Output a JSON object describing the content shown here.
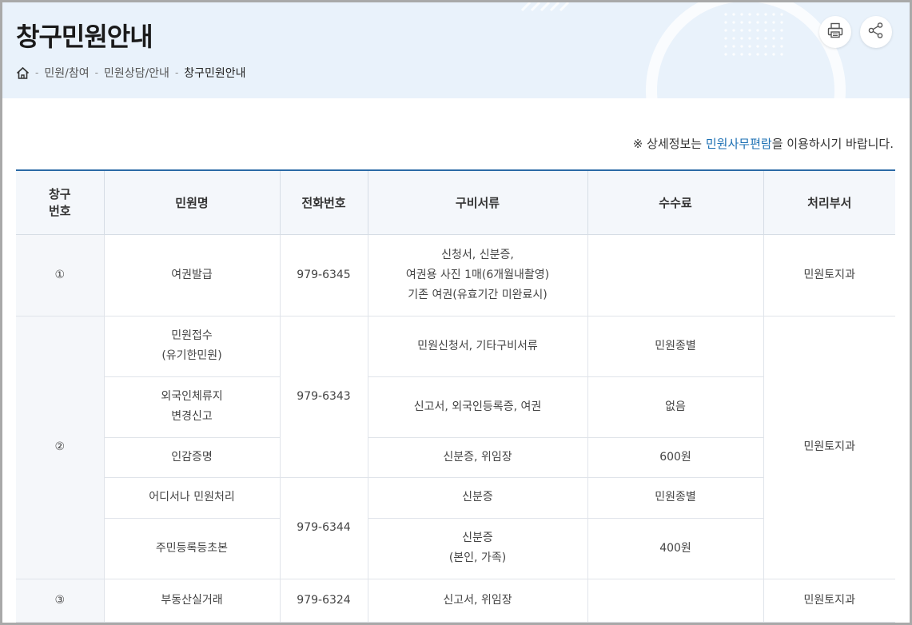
{
  "header": {
    "title": "창구민원안내",
    "breadcrumb": [
      "민원/참여",
      "민원상담/안내",
      "창구민원안내"
    ],
    "separator": "-",
    "icons": {
      "home": "home-icon",
      "print": "print-icon",
      "share": "share-icon"
    }
  },
  "notice": {
    "prefix": "※ 상세정보는 ",
    "link": "민원사무편람",
    "suffix": "을 이용하시기 바랍니다."
  },
  "table": {
    "headers": {
      "num_line1": "창구",
      "num_line2": "번호",
      "name": "민원명",
      "phone": "전화번호",
      "docs": "구비서류",
      "fee": "수수료",
      "dept": "처리부서"
    },
    "groups": [
      {
        "num": "①",
        "dept": "민원토지과",
        "rows": [
          {
            "name": [
              "여권발급"
            ],
            "phone": "979-6345",
            "docs": [
              "신청서, 신분증,",
              "여권용 사진 1매(6개월내촬영)",
              "기존 여권(유효기간 미완료시)"
            ],
            "fee": ""
          }
        ]
      },
      {
        "num": "②",
        "dept": "민원토지과",
        "rows": [
          {
            "name": [
              "민원접수",
              "(유기한민원)"
            ],
            "phone": "979-6343",
            "docs": [
              "민원신청서, 기타구비서류"
            ],
            "fee": "민원종별"
          },
          {
            "name": [
              "외국인체류지",
              "변경신고"
            ],
            "docs": [
              "신고서, 외국인등록증, 여권"
            ],
            "fee": "없음"
          },
          {
            "name": [
              "인감증명"
            ],
            "docs": [
              "신분증, 위임장"
            ],
            "fee": "600원"
          },
          {
            "name": [
              "어디서나 민원처리"
            ],
            "phone": "979-6344",
            "docs": [
              "신분증"
            ],
            "fee": "민원종별"
          },
          {
            "name": [
              "주민등록등초본"
            ],
            "docs": [
              "신분증",
              "(본인, 가족)"
            ],
            "fee": "400원"
          }
        ]
      },
      {
        "num": "③",
        "dept": "민원토지과",
        "rows": [
          {
            "name": [
              "부동산실거래"
            ],
            "phone": "979-6324",
            "docs": [
              "신고서, 위임장"
            ],
            "fee": ""
          }
        ]
      }
    ]
  },
  "colors": {
    "header_bg": "#e9f2fb",
    "accent": "#2b6aa6",
    "link": "#1b6fb3",
    "header_cell_bg": "#f4f7fb"
  }
}
